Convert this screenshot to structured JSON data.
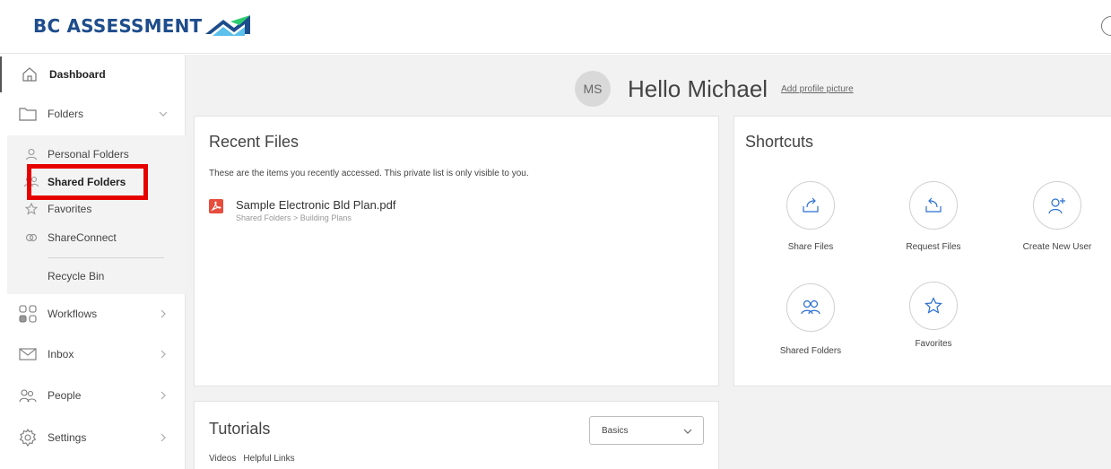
{
  "brand": {
    "name": "BC ASSESSMENT",
    "color": "#1e4d8c"
  },
  "sidebar": {
    "items": [
      {
        "key": "dashboard",
        "label": "Dashboard",
        "icon": "home-icon"
      },
      {
        "key": "folders",
        "label": "Folders",
        "icon": "folder-icon"
      },
      {
        "key": "workflows",
        "label": "Workflows",
        "icon": "workflows-icon"
      },
      {
        "key": "inbox",
        "label": "Inbox",
        "icon": "mail-icon"
      },
      {
        "key": "people",
        "label": "People",
        "icon": "people-icon"
      },
      {
        "key": "settings",
        "label": "Settings",
        "icon": "gear-icon"
      }
    ],
    "folders_sub": [
      {
        "label": "Personal Folders",
        "icon": "user-icon"
      },
      {
        "label": "Shared Folders",
        "icon": "users-icon"
      },
      {
        "label": "Favorites",
        "icon": "star-icon"
      },
      {
        "label": "ShareConnect",
        "icon": "shareconnect-icon"
      },
      {
        "label": "Recycle Bin",
        "icon": ""
      }
    ],
    "highlight_color": "#e60000"
  },
  "greeting": {
    "initials": "MS",
    "text": "Hello Michael",
    "add_picture": "Add profile picture"
  },
  "recent": {
    "title": "Recent Files",
    "description": "These are the items you recently accessed. This private list is only visible to you.",
    "files": [
      {
        "name": "Sample Electronic Bld Plan.pdf",
        "path": "Shared Folders > Building Plans",
        "icon": "pdf-icon"
      }
    ]
  },
  "shortcuts": {
    "title": "Shortcuts",
    "items": [
      {
        "label": "Share Files",
        "icon": "share-icon"
      },
      {
        "label": "Request Files",
        "icon": "request-icon"
      },
      {
        "label": "Create New User",
        "icon": "add-user-icon"
      },
      {
        "label": "Shared Folders",
        "icon": "users-icon"
      },
      {
        "label": "Favorites",
        "icon": "star-icon"
      }
    ],
    "accent": "#2a6fd1"
  },
  "tutorials": {
    "title": "Tutorials",
    "selected": "Basics",
    "tabs": [
      "Videos",
      "Helpful Links"
    ]
  }
}
